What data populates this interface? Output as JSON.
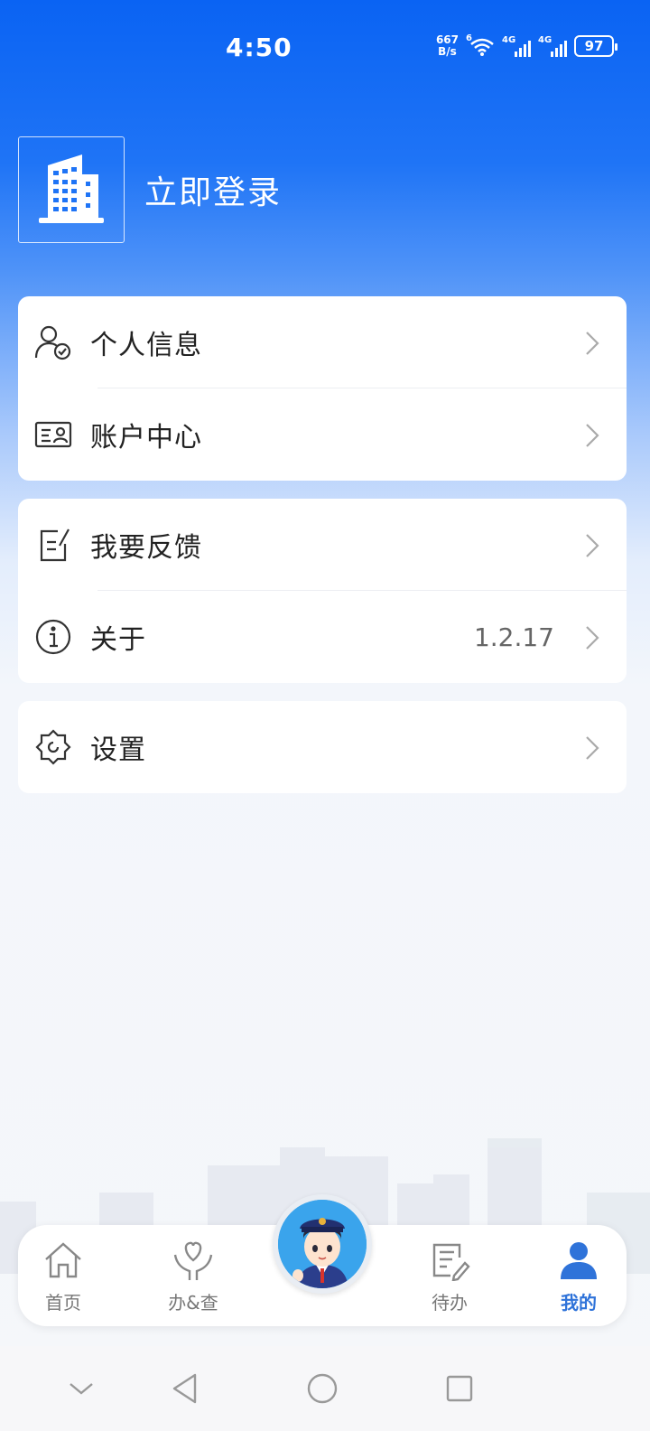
{
  "status_bar": {
    "time": "4:50",
    "net_speed_value": "667",
    "net_speed_unit": "B/s",
    "wifi_label": "6",
    "signal1_label": "4G",
    "signal2_label": "4G",
    "battery": "97"
  },
  "header": {
    "login_text": "立即登录",
    "avatar_icon": "building-icon"
  },
  "menu_groups": [
    {
      "items": [
        {
          "icon": "user-check-icon",
          "label": "个人信息"
        },
        {
          "icon": "id-card-icon",
          "label": "账户中心"
        }
      ]
    },
    {
      "items": [
        {
          "icon": "feedback-edit-icon",
          "label": "我要反馈"
        },
        {
          "icon": "info-icon",
          "label": "关于",
          "value": "1.2.17"
        }
      ]
    },
    {
      "items": [
        {
          "icon": "settings-gear-icon",
          "label": "设置"
        }
      ]
    }
  ],
  "tabbar": {
    "tabs": [
      {
        "icon": "home-icon",
        "label": "首页",
        "active": false
      },
      {
        "icon": "heart-hands-icon",
        "label": "办&查",
        "active": false
      },
      {
        "icon": "todo-edit-icon",
        "label": "待办",
        "active": false
      },
      {
        "icon": "person-icon",
        "label": "我的",
        "active": true
      }
    ],
    "center_button": "officer-avatar-icon"
  },
  "colors": {
    "primary_blue": "#0a63f3",
    "active_tab": "#2f73d9"
  }
}
